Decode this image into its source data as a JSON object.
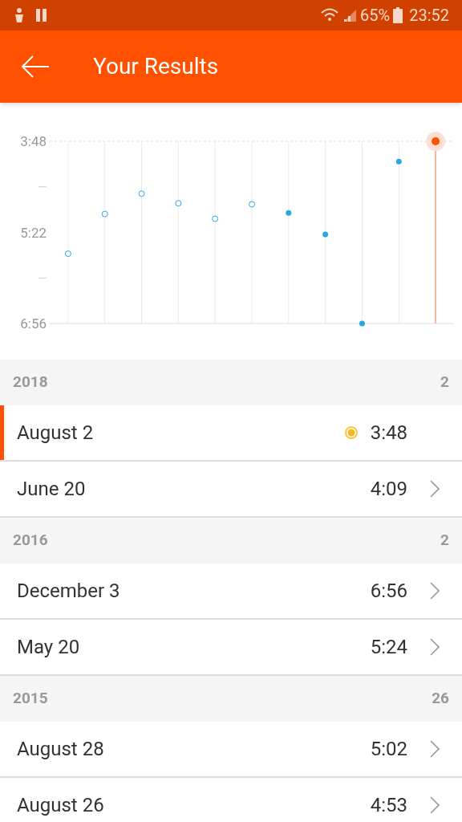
{
  "status_bar": {
    "battery": "65%",
    "time": "23:52"
  },
  "app_bar": {
    "title": "Your Results"
  },
  "chart": {
    "points": [
      {
        "hollow": true,
        "highlight": false
      },
      {
        "hollow": true,
        "highlight": false
      },
      {
        "hollow": true,
        "highlight": false
      },
      {
        "hollow": true,
        "highlight": false
      },
      {
        "hollow": true,
        "highlight": false
      },
      {
        "hollow": true,
        "highlight": false
      },
      {
        "hollow": false,
        "highlight": false
      },
      {
        "hollow": false,
        "highlight": false
      },
      {
        "hollow": false,
        "highlight": false
      },
      {
        "hollow": false,
        "highlight": false
      },
      {
        "hollow": false,
        "highlight": true
      }
    ],
    "chart_data": {
      "type": "scatter",
      "grid": true,
      "ylim": [
        416,
        228
      ],
      "yticks": [
        {
          "value": 228,
          "label": "3:48"
        },
        {
          "value": 322,
          "label": "5:22"
        },
        {
          "value": 416,
          "label": "6:56"
        }
      ],
      "series": [
        {
          "marker": "circle",
          "color": "#29a8e0",
          "values": [
            344,
            303,
            282,
            292,
            308,
            293,
            302,
            324,
            416,
            249,
            null
          ]
        },
        {
          "marker": "circle",
          "color": "#ff5000",
          "values": [
            null,
            null,
            null,
            null,
            null,
            null,
            null,
            null,
            null,
            null,
            228
          ]
        }
      ]
    }
  },
  "sections": [
    {
      "year": "2018",
      "count": "2",
      "rows": [
        {
          "date": "August 2",
          "time": "3:48",
          "selected": true,
          "best": true
        },
        {
          "date": "June 20",
          "time": "4:09",
          "selected": false,
          "best": false
        }
      ]
    },
    {
      "year": "2016",
      "count": "2",
      "rows": [
        {
          "date": "December 3",
          "time": "6:56",
          "selected": false,
          "best": false
        },
        {
          "date": "May 20",
          "time": "5:24",
          "selected": false,
          "best": false
        }
      ]
    },
    {
      "year": "2015",
      "count": "26",
      "rows": [
        {
          "date": "August 28",
          "time": "5:02",
          "selected": false,
          "best": false
        },
        {
          "date": "August 26",
          "time": "4:53",
          "selected": false,
          "best": false
        }
      ]
    }
  ]
}
